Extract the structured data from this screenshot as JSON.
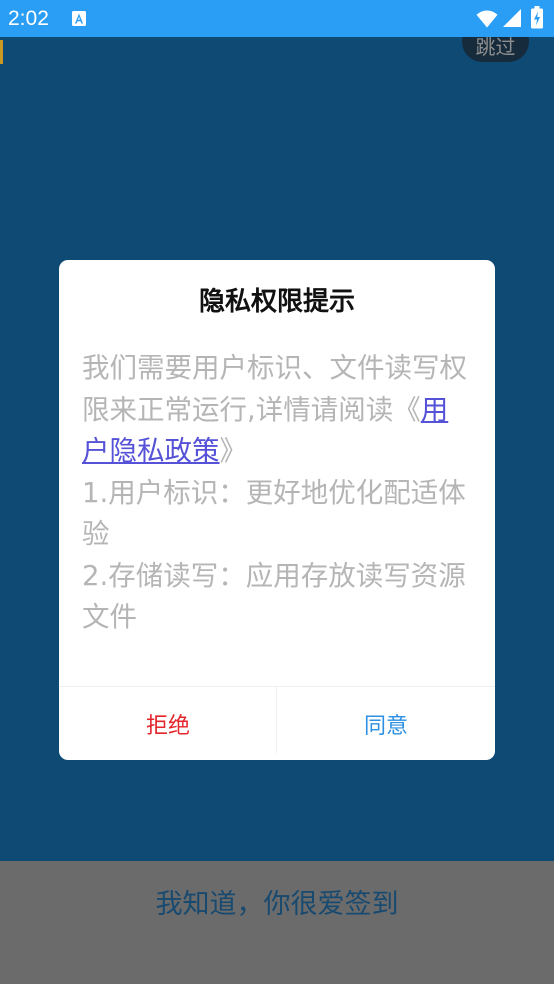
{
  "status_bar": {
    "time": "2:02",
    "icons": {
      "notification": "a-icon",
      "wifi": "wifi-icon",
      "signal": "signal-icon",
      "battery": "battery-charging-icon"
    }
  },
  "skip_button": {
    "label": "跳过"
  },
  "dialog": {
    "title": "隐私权限提示",
    "body": {
      "intro_before": "我们需要用户标识、文件读写权限来正常运行,详情请阅读《",
      "policy_link": "用户隐私政策",
      "intro_after": "》",
      "items": [
        "1.用户标识：更好地优化配适体验",
        "2.存储读写：应用存放读写资源文件"
      ]
    },
    "buttons": {
      "reject": "拒绝",
      "agree": "同意"
    }
  },
  "bottom_bar": {
    "label": "我知道，你很爱签到"
  },
  "colors": {
    "status_bar": "#2a9ef4",
    "page_background": "#0e4a74",
    "reject_button": "#e3262b",
    "agree_button": "#2d90e2",
    "policy_link": "#5652d8",
    "bottom_bar": "#6b6b6b",
    "bottom_bar_text": "#18496f",
    "skip_button": "#162b3c"
  }
}
